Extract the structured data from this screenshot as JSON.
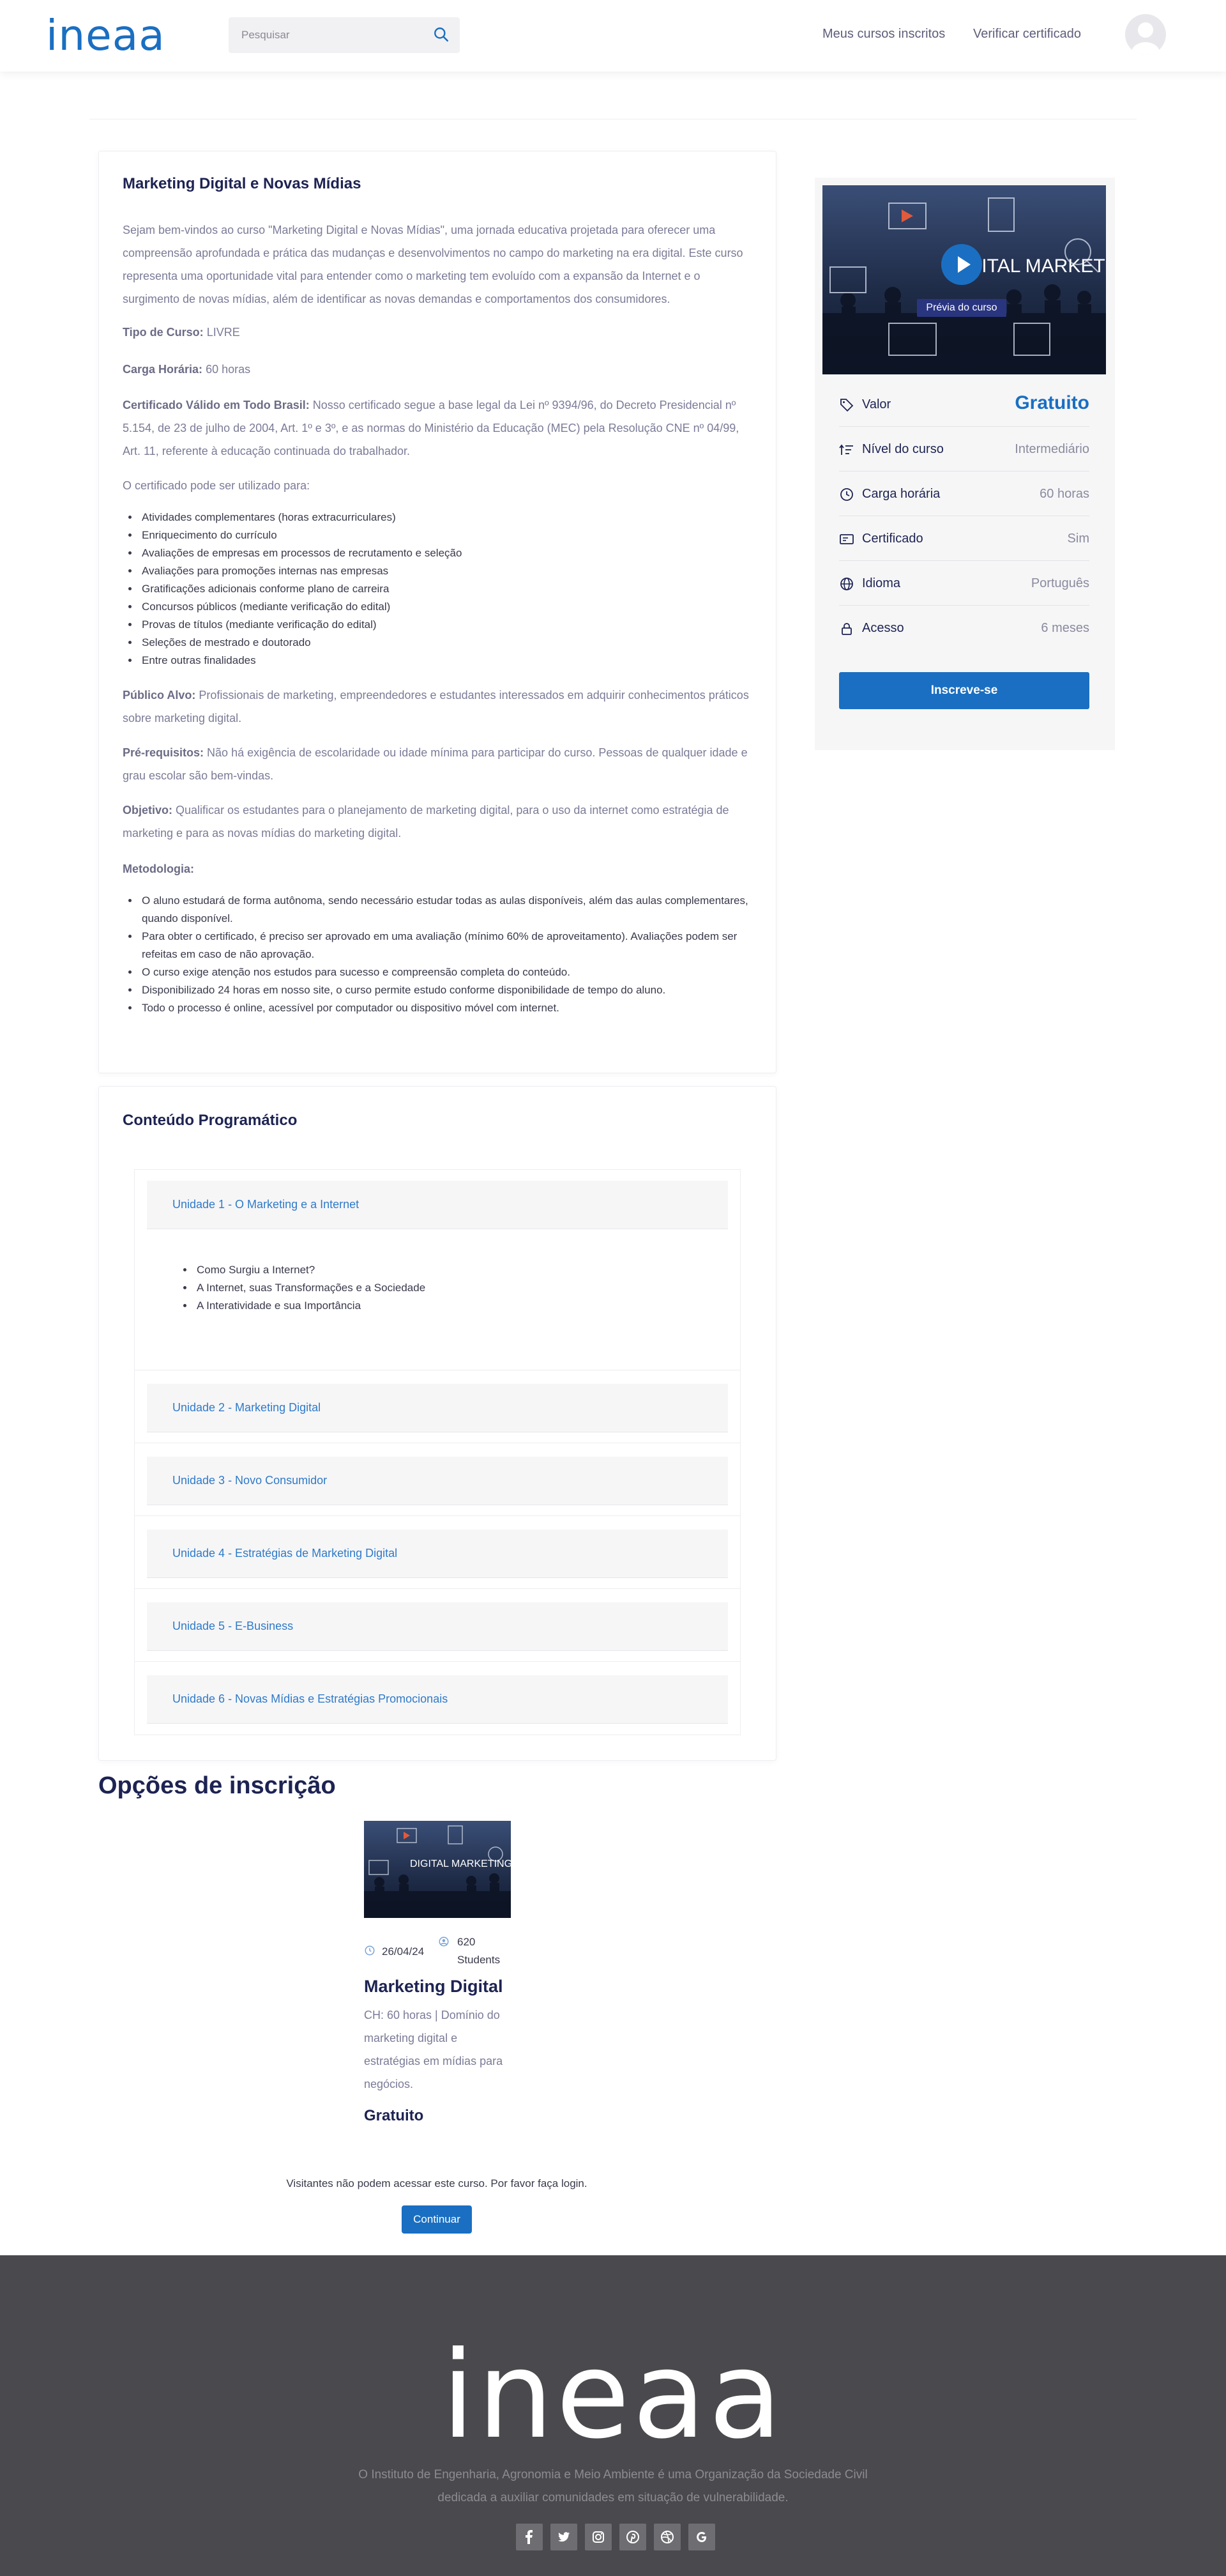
{
  "header": {
    "logo": "ineaa",
    "search_placeholder": "Pesquisar",
    "nav": [
      "Meus cursos inscritos",
      "Verificar certificado"
    ]
  },
  "course": {
    "title": "Marketing Digital e Novas Mídias",
    "intro": "Sejam bem-vindos ao curso \"Marketing Digital e Novas Mídias\", uma jornada educativa projetada para oferecer uma compreensão aprofundada e prática das mudanças e desenvolvimentos no campo do marketing na era digital. Este curso representa uma oportunidade vital para entender como o marketing tem evoluído com a expansão da Internet e o surgimento de novas mídias, além de identificar as novas demandas e comportamentos dos consumidores.",
    "tipo_label": "Tipo de Curso:",
    "tipo_value": "LIVRE",
    "carga_label": "Carga Horária:",
    "carga_value": "60 horas",
    "cert_label": "Certificado Válido em Todo Brasil:",
    "cert_value": "Nosso certificado segue a base legal da Lei nº 9394/96, do Decreto Presidencial nº 5.154, de 23 de julho de 2004, Art. 1º e 3º, e as normas do Ministério da Educação (MEC) pela Resolução CNE nº 04/99, Art. 11, referente à educação continuada do trabalhador.",
    "uses_intro": "O certificado pode ser utilizado para:",
    "uses": [
      "Atividades complementares (horas extracurriculares)",
      "Enriquecimento do currículo",
      "Avaliações de empresas em processos de recrutamento e seleção",
      "Avaliações para promoções internas nas empresas",
      "Gratificações adicionais conforme plano de carreira",
      "Concursos públicos (mediante verificação do edital)",
      "Provas de títulos (mediante verificação do edital)",
      "Seleções de mestrado e doutorado",
      "Entre outras finalidades"
    ],
    "publico_label": "Público Alvo:",
    "publico_value": "Profissionais de marketing, empreendedores e estudantes interessados em adquirir conhecimentos práticos sobre marketing digital.",
    "prereq_label": "Pré-requisitos:",
    "prereq_value": "Não há exigência de escolaridade ou idade mínima para participar do curso. Pessoas de qualquer idade e grau escolar são bem-vindas.",
    "objetivo_label": "Objetivo:",
    "objetivo_value": "Qualificar os estudantes para o planejamento de marketing digital, para o uso da internet como estratégia de marketing e para as novas mídias do marketing digital.",
    "metodologia_label": "Metodologia:",
    "metodologia": [
      "O aluno estudará de forma autônoma, sendo necessário estudar todas as aulas disponíveis, além das aulas complementares, quando disponível.",
      "Para obter o certificado, é preciso ser aprovado em uma avaliação (mínimo 60% de aproveitamento). Avaliações podem ser refeitas em caso de não aprovação.",
      "O curso exige atenção nos estudos para sucesso e compreensão completa do conteúdo.",
      "Disponibilizado 24 horas em nosso site, o curso permite estudo conforme disponibilidade de tempo do aluno.",
      "Todo o processo é online, acessível por computador ou dispositivo móvel com internet."
    ]
  },
  "program": {
    "title": "Conteúdo Programático",
    "units": [
      "Unidade 1 - O Marketing e a Internet",
      "Unidade 2 - Marketing Digital",
      "Unidade 3 - Novo Consumidor",
      "Unidade 4 - Estratégias de Marketing Digital",
      "Unidade 5 - E-Business",
      "Unidade 6 - Novas Mídias e Estratégias Promocionais"
    ],
    "unit1_topics": [
      "Como Surgiu a Internet?",
      "A Internet, suas Transformações e a Sociedade",
      "A Interatividade e sua Importância"
    ]
  },
  "sidebar": {
    "preview_image_text": "DIGITAL MARKETING",
    "preview_label": "Prévia do curso",
    "rows": [
      {
        "label": "Valor",
        "value": "Gratuito",
        "icon": "tag-icon"
      },
      {
        "label": "Nível do curso",
        "value": "Intermediário",
        "icon": "level-icon"
      },
      {
        "label": "Carga horária",
        "value": "60 horas",
        "icon": "clock-icon"
      },
      {
        "label": "Certificado",
        "value": "Sim",
        "icon": "certificate-icon"
      },
      {
        "label": "Idioma",
        "value": "Português",
        "icon": "globe-icon"
      },
      {
        "label": "Acesso",
        "value": "6 meses",
        "icon": "lock-icon"
      }
    ],
    "enroll_label": "Inscreve-se"
  },
  "options": {
    "title": "Opções de inscrição",
    "card": {
      "image_text": "DIGITAL MARKETING",
      "date": "26/04/24",
      "students_count": "620",
      "students_label": "Students",
      "name": "Marketing Digital",
      "desc": "CH: 60 horas | Domínio do marketing digital e estratégias em mídias para negócios.",
      "price": "Gratuito"
    },
    "login_msg": "Visitantes não podem acessar este curso. Por favor faça login.",
    "continue_label": "Continuar"
  },
  "footer": {
    "logo": "ineaa",
    "text": "O Instituto de Engenharia, Agronomia e Meio Ambiente é uma Organização da Sociedade Civil dedicada a auxiliar comunidades em situação de vulnerabilidade.",
    "social_icons": [
      "facebook-icon",
      "twitter-icon",
      "instagram-icon",
      "pinterest-icon",
      "dribbble-icon",
      "google-icon"
    ]
  },
  "colors": {
    "brand": "#1a6fc2",
    "heading": "#1d2352",
    "footer_bg": "#4a494d"
  }
}
